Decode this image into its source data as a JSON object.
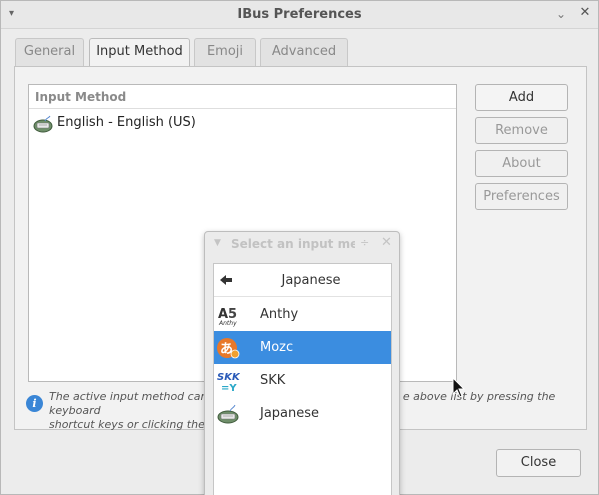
{
  "window": {
    "title": "IBus Preferences",
    "menu_glyph": "▾",
    "minimize_glyph": "⌄",
    "close_glyph": "✕"
  },
  "tabs": [
    {
      "label": "General"
    },
    {
      "label": "Input Method"
    },
    {
      "label": "Emoji"
    },
    {
      "label": "Advanced"
    }
  ],
  "input_methods": {
    "header": "Input Method",
    "items": [
      {
        "label": "English - English (US)",
        "icon": "keyboard-icon"
      }
    ]
  },
  "buttons": {
    "add": "Add",
    "remove": "Remove",
    "about": "About",
    "preferences": "Preferences",
    "close": "Close"
  },
  "info": {
    "text_part1": "The active input method can be sw",
    "text_part2": "e above list by pressing the keyboard",
    "text_line2": "shortcut keys or clicking the panel"
  },
  "popup": {
    "title": "Select an input meth",
    "header_label": "Japanese",
    "items": [
      {
        "label": "Anthy",
        "icon": "anthy-icon",
        "selected": false
      },
      {
        "label": "Mozc",
        "icon": "mozc-icon",
        "selected": true
      },
      {
        "label": "SKK",
        "icon": "skk-icon",
        "selected": false
      },
      {
        "label": "Japanese",
        "icon": "keyboard-icon",
        "selected": false
      }
    ]
  },
  "colors": {
    "selection": "#3b8de0",
    "info_icon": "#3a86d6"
  }
}
